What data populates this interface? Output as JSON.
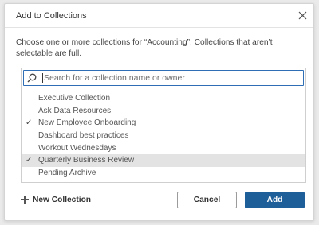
{
  "dialog": {
    "title": "Add to Collections",
    "description": "Choose one or more collections for “Accounting”. Collections that aren’t selectable are full.",
    "search": {
      "placeholder": "Search for a collection name or owner",
      "value": ""
    },
    "collections": [
      {
        "label": "Executive Collection",
        "checked": false,
        "highlighted": false
      },
      {
        "label": "Ask Data Resources",
        "checked": false,
        "highlighted": false
      },
      {
        "label": "New Employee Onboarding",
        "checked": true,
        "highlighted": false
      },
      {
        "label": "Dashboard best practices",
        "checked": false,
        "highlighted": false
      },
      {
        "label": "Workout Wednesdays",
        "checked": false,
        "highlighted": false
      },
      {
        "label": "Quarterly Business Review",
        "checked": true,
        "highlighted": true
      },
      {
        "label": "Pending Archive",
        "checked": false,
        "highlighted": false
      }
    ],
    "check_glyph": "✓",
    "new_collection_label": "New Collection",
    "cancel_label": "Cancel",
    "add_label": "Add"
  },
  "icons": {
    "close": "close-icon",
    "search": "search-icon",
    "plus": "plus-icon"
  },
  "colors": {
    "accent": "#1f5f99",
    "search_border": "#2f6db5",
    "highlight_row": "#e3e3e3"
  }
}
